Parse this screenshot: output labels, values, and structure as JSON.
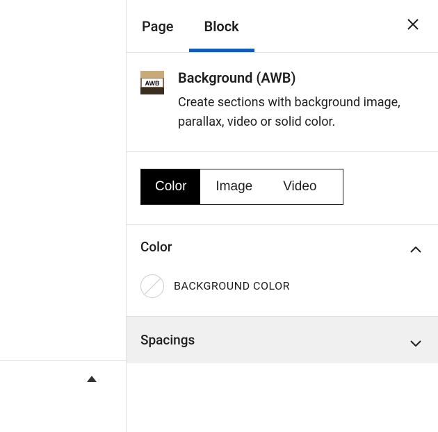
{
  "tabs": {
    "page_label": "Page",
    "block_label": "Block"
  },
  "block": {
    "title": "Background (AWB)",
    "description": "Create sections with background image, parallax, video or solid color."
  },
  "type_selector": {
    "color": "Color",
    "image": "Image",
    "video": "Video"
  },
  "sections": {
    "color_title": "Color",
    "background_color_label": "BACKGROUND COLOR",
    "spacings_title": "Spacings"
  }
}
